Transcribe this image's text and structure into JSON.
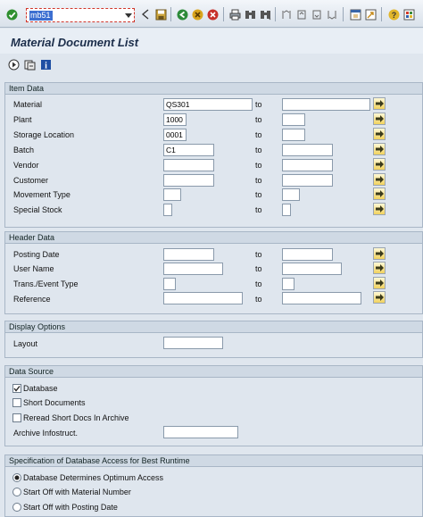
{
  "toolbar": {
    "command_field_value": "mb51"
  },
  "page": {
    "title": "Material Document List"
  },
  "sections": {
    "item_data": {
      "title": "Item Data",
      "to_label": "to",
      "rows": [
        {
          "label": "Material",
          "from": "QS301",
          "to": ""
        },
        {
          "label": "Plant",
          "from": "1000",
          "to": ""
        },
        {
          "label": "Storage Location",
          "from": "0001",
          "to": ""
        },
        {
          "label": "Batch",
          "from": "C1",
          "to": ""
        },
        {
          "label": "Vendor",
          "from": "",
          "to": ""
        },
        {
          "label": "Customer",
          "from": "",
          "to": ""
        },
        {
          "label": "Movement Type",
          "from": "",
          "to": ""
        },
        {
          "label": "Special Stock",
          "from": "",
          "to": ""
        }
      ]
    },
    "header_data": {
      "title": "Header Data",
      "rows": [
        {
          "label": "Posting Date",
          "from": "",
          "to": ""
        },
        {
          "label": "User Name",
          "from": "",
          "to": ""
        },
        {
          "label": "Trans./Event Type",
          "from": "",
          "to": ""
        },
        {
          "label": "Reference",
          "from": "",
          "to": ""
        }
      ]
    },
    "display_options": {
      "title": "Display Options",
      "layout_label": "Layout",
      "layout_value": ""
    },
    "data_source": {
      "title": "Data Source",
      "database_label": "Database",
      "database_checked": true,
      "short_docs_label": "Short Documents",
      "short_docs_checked": false,
      "reread_label": "Reread Short Docs In Archive",
      "reread_checked": false,
      "archive_label": "Archive Infostruct.",
      "archive_value": ""
    },
    "db_access": {
      "title": "Specification of Database Access for Best Runtime",
      "options": [
        {
          "label": "Database Determines Optimum Access",
          "selected": true
        },
        {
          "label": "Start Off with Material Number",
          "selected": false
        },
        {
          "label": "Start Off with Posting Date",
          "selected": false
        }
      ]
    }
  },
  "colors": {
    "accent": "#3c6fd1",
    "multi_button": "#f1d25e",
    "group_header": "#cfd9e4",
    "background": "#dfe6ee"
  }
}
